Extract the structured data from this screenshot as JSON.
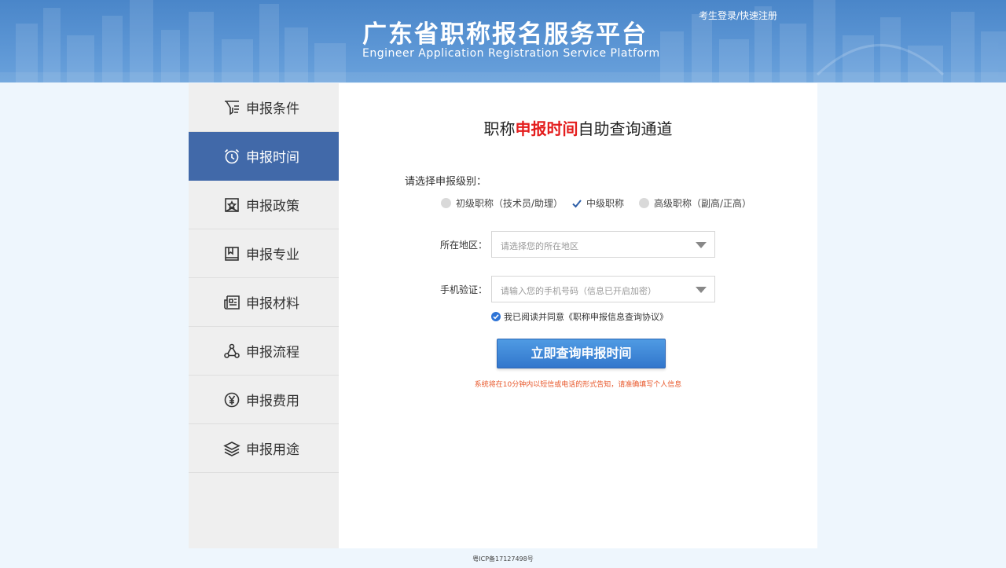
{
  "header": {
    "title": "广东省职称报名服务平台",
    "subtitle": "Engineer Application Registration Service Platform",
    "login_link": "考生登录/快速注册"
  },
  "sidebar": {
    "items": [
      {
        "label": "申报条件",
        "icon": "filter-list-icon",
        "active": false
      },
      {
        "label": "申报时间",
        "icon": "alarm-clock-icon",
        "active": true
      },
      {
        "label": "申报政策",
        "icon": "document-star-icon",
        "active": false
      },
      {
        "label": "申报专业",
        "icon": "bookmark-book-icon",
        "active": false
      },
      {
        "label": "申报材料",
        "icon": "newspaper-icon",
        "active": false
      },
      {
        "label": "申报流程",
        "icon": "workflow-nodes-icon",
        "active": false
      },
      {
        "label": "申报费用",
        "icon": "yen-coin-icon",
        "active": false
      },
      {
        "label": "申报用途",
        "icon": "layers-icon",
        "active": false
      }
    ]
  },
  "main": {
    "title_prefix": "职称",
    "title_highlight": "申报时间",
    "title_suffix": "自助查询通道",
    "level_label": "请选择申报级别：",
    "levels": [
      {
        "label": "初级职称（技术员/助理）",
        "selected": false
      },
      {
        "label": "中级职称",
        "selected": true
      },
      {
        "label": "高级职称（副高/正高）",
        "selected": false
      }
    ],
    "region": {
      "label": "所在地区：",
      "placeholder": "请选择您的所在地区"
    },
    "phone": {
      "label": "手机验证：",
      "placeholder": "请输入您的手机号码（信息已开启加密）"
    },
    "agreement": "我已阅读并同意《职称申报信息查询协议》",
    "submit_label": "立即查询申报时间",
    "notice": "系统将在10分钟内以短信或电话的形式告知，请准确填写个人信息"
  },
  "footer": {
    "icp": "粤ICP备17127498号"
  },
  "colors": {
    "header_blue": "#4a86c9",
    "active_nav": "#4169a9",
    "highlight_red": "#e41d1d",
    "notice_orange": "#e8572a",
    "button_blue": "#3276cc"
  }
}
